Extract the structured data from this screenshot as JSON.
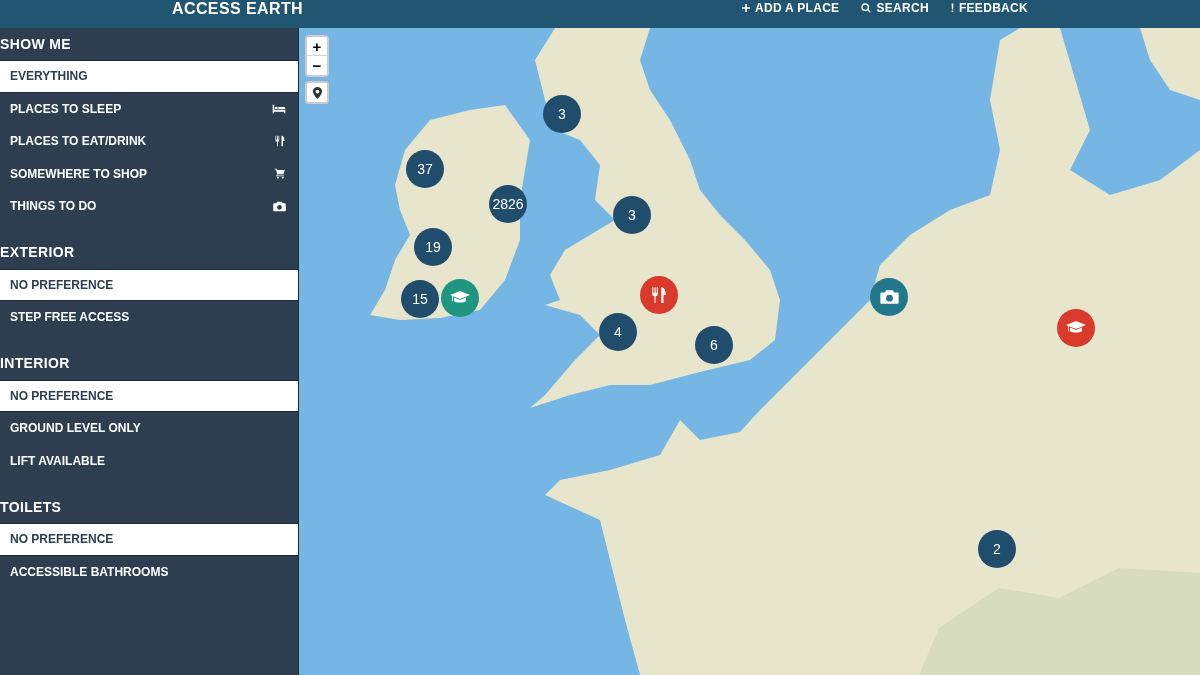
{
  "header": {
    "logo": "ACCESS EARTH",
    "nav": [
      {
        "kind": "add",
        "label": "ADD A PLACE"
      },
      {
        "kind": "search",
        "label": "SEARCH"
      },
      {
        "kind": "feedback",
        "label": "FEEDBACK"
      }
    ]
  },
  "sidebar": {
    "sections": [
      {
        "title": "SHOW ME",
        "items": [
          {
            "label": "EVERYTHING",
            "kind": "plain",
            "selected": true
          },
          {
            "label": "PLACES TO SLEEP",
            "kind": "sleep",
            "selected": false
          },
          {
            "label": "PLACES TO EAT/DRINK",
            "kind": "eat",
            "selected": false
          },
          {
            "label": "SOMEWHERE TO SHOP",
            "kind": "shop",
            "selected": false
          },
          {
            "label": "THINGS TO DO",
            "kind": "do",
            "selected": false
          }
        ]
      },
      {
        "title": "EXTERIOR",
        "items": [
          {
            "label": "NO PREFERENCE",
            "kind": "plain",
            "selected": true
          },
          {
            "label": "STEP FREE ACCESS",
            "kind": "plain",
            "selected": false
          }
        ]
      },
      {
        "title": "INTERIOR",
        "items": [
          {
            "label": "NO PREFERENCE",
            "kind": "plain",
            "selected": true
          },
          {
            "label": "GROUND LEVEL ONLY",
            "kind": "plain",
            "selected": false
          },
          {
            "label": "LIFT AVAILABLE",
            "kind": "plain",
            "selected": false
          }
        ]
      },
      {
        "title": "TOILETS",
        "items": [
          {
            "label": "NO PREFERENCE",
            "kind": "plain",
            "selected": true
          },
          {
            "label": "ACCESSIBLE BATHROOMS",
            "kind": "plain",
            "selected": false
          }
        ]
      }
    ]
  },
  "map": {
    "zoom_in": "+",
    "zoom_out": "−",
    "markers": [
      {
        "kind": "cluster",
        "count": "3",
        "color": "#1f4d6b"
      },
      {
        "kind": "cluster",
        "count": "37",
        "color": "#1f4d6b"
      },
      {
        "kind": "cluster",
        "count": "2826",
        "color": "#1f4d6b"
      },
      {
        "kind": "cluster",
        "count": "3",
        "color": "#1f4d6b"
      },
      {
        "kind": "cluster",
        "count": "19",
        "color": "#1f4d6b"
      },
      {
        "kind": "dining",
        "color": "#d93a2b"
      },
      {
        "kind": "camera",
        "color": "#22788a"
      },
      {
        "kind": "education",
        "color": "#1f9680"
      },
      {
        "kind": "cluster",
        "count": "15",
        "color": "#1f4d6b"
      },
      {
        "kind": "education",
        "color": "#d93a2b"
      },
      {
        "kind": "cluster",
        "count": "4",
        "color": "#1f4d6b"
      },
      {
        "kind": "cluster",
        "count": "6",
        "color": "#1f4d6b"
      },
      {
        "kind": "cluster",
        "count": "2",
        "color": "#1f4d6b"
      }
    ]
  }
}
